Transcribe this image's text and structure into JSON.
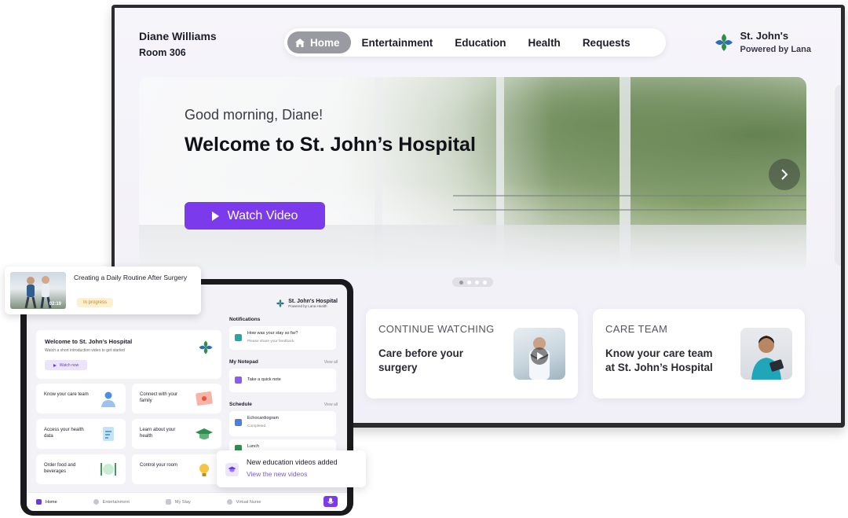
{
  "tv": {
    "user": {
      "name": "Diane Williams",
      "room": "Room 306"
    },
    "nav": [
      "Home",
      "Entertainment",
      "Education",
      "Health",
      "Requests"
    ],
    "brand": {
      "title": "St. John's",
      "subtitle": "Powered by Lana"
    },
    "hero": {
      "greeting": "Good morning, Diane!",
      "title": "Welcome to St. John’s Hospital",
      "button": "Watch Video"
    },
    "carousel": {
      "slides": 4,
      "active": 0
    },
    "cards": [
      {
        "label": "CONTINUE WATCHING",
        "text": "Care before your surgery"
      },
      {
        "label": "CARE TEAM",
        "text": "Know your care team at St. John’s Hospital"
      }
    ]
  },
  "tablet": {
    "brand": {
      "title": "St. John's Hospital",
      "subtitle": "Powered by Lana Health"
    },
    "welcome": {
      "title": "Welcome to St. John’s Hospital",
      "subtitle": "Watch a short introduction video to get started",
      "button": "Watch now"
    },
    "tiles": [
      {
        "label": "Know your care team"
      },
      {
        "label": "Connect with your family"
      },
      {
        "label": "Access your health data"
      },
      {
        "label": "Learn about your health"
      },
      {
        "label": "Order food and beverages"
      },
      {
        "label": "Control your room"
      }
    ],
    "notifications": {
      "heading": "Notifications",
      "item": {
        "title": "How was your stay so far?",
        "subtitle": "Please share your feedback"
      }
    },
    "notepad": {
      "heading": "My Notepad",
      "view_all": "View all",
      "item": "Take a quick note"
    },
    "schedule": {
      "heading": "Schedule",
      "view_all": "View all",
      "items": [
        {
          "title": "Echocardiogram",
          "status": "Completed"
        },
        {
          "title": "Lunch"
        }
      ]
    },
    "bottom_nav": [
      "Home",
      "Entertainment",
      "My Stay",
      "Virtual Nurse"
    ]
  },
  "popups": {
    "video": {
      "title": "Creating a Daily Routine After Surgery",
      "duration": "02:19",
      "status": "In progress"
    },
    "education": {
      "title": "New education videos added",
      "link": "View the new videos"
    }
  },
  "colors": {
    "accent": "#7c3aed",
    "brand_green": "#2f8f4a",
    "brand_blue": "#2a6cb5"
  }
}
